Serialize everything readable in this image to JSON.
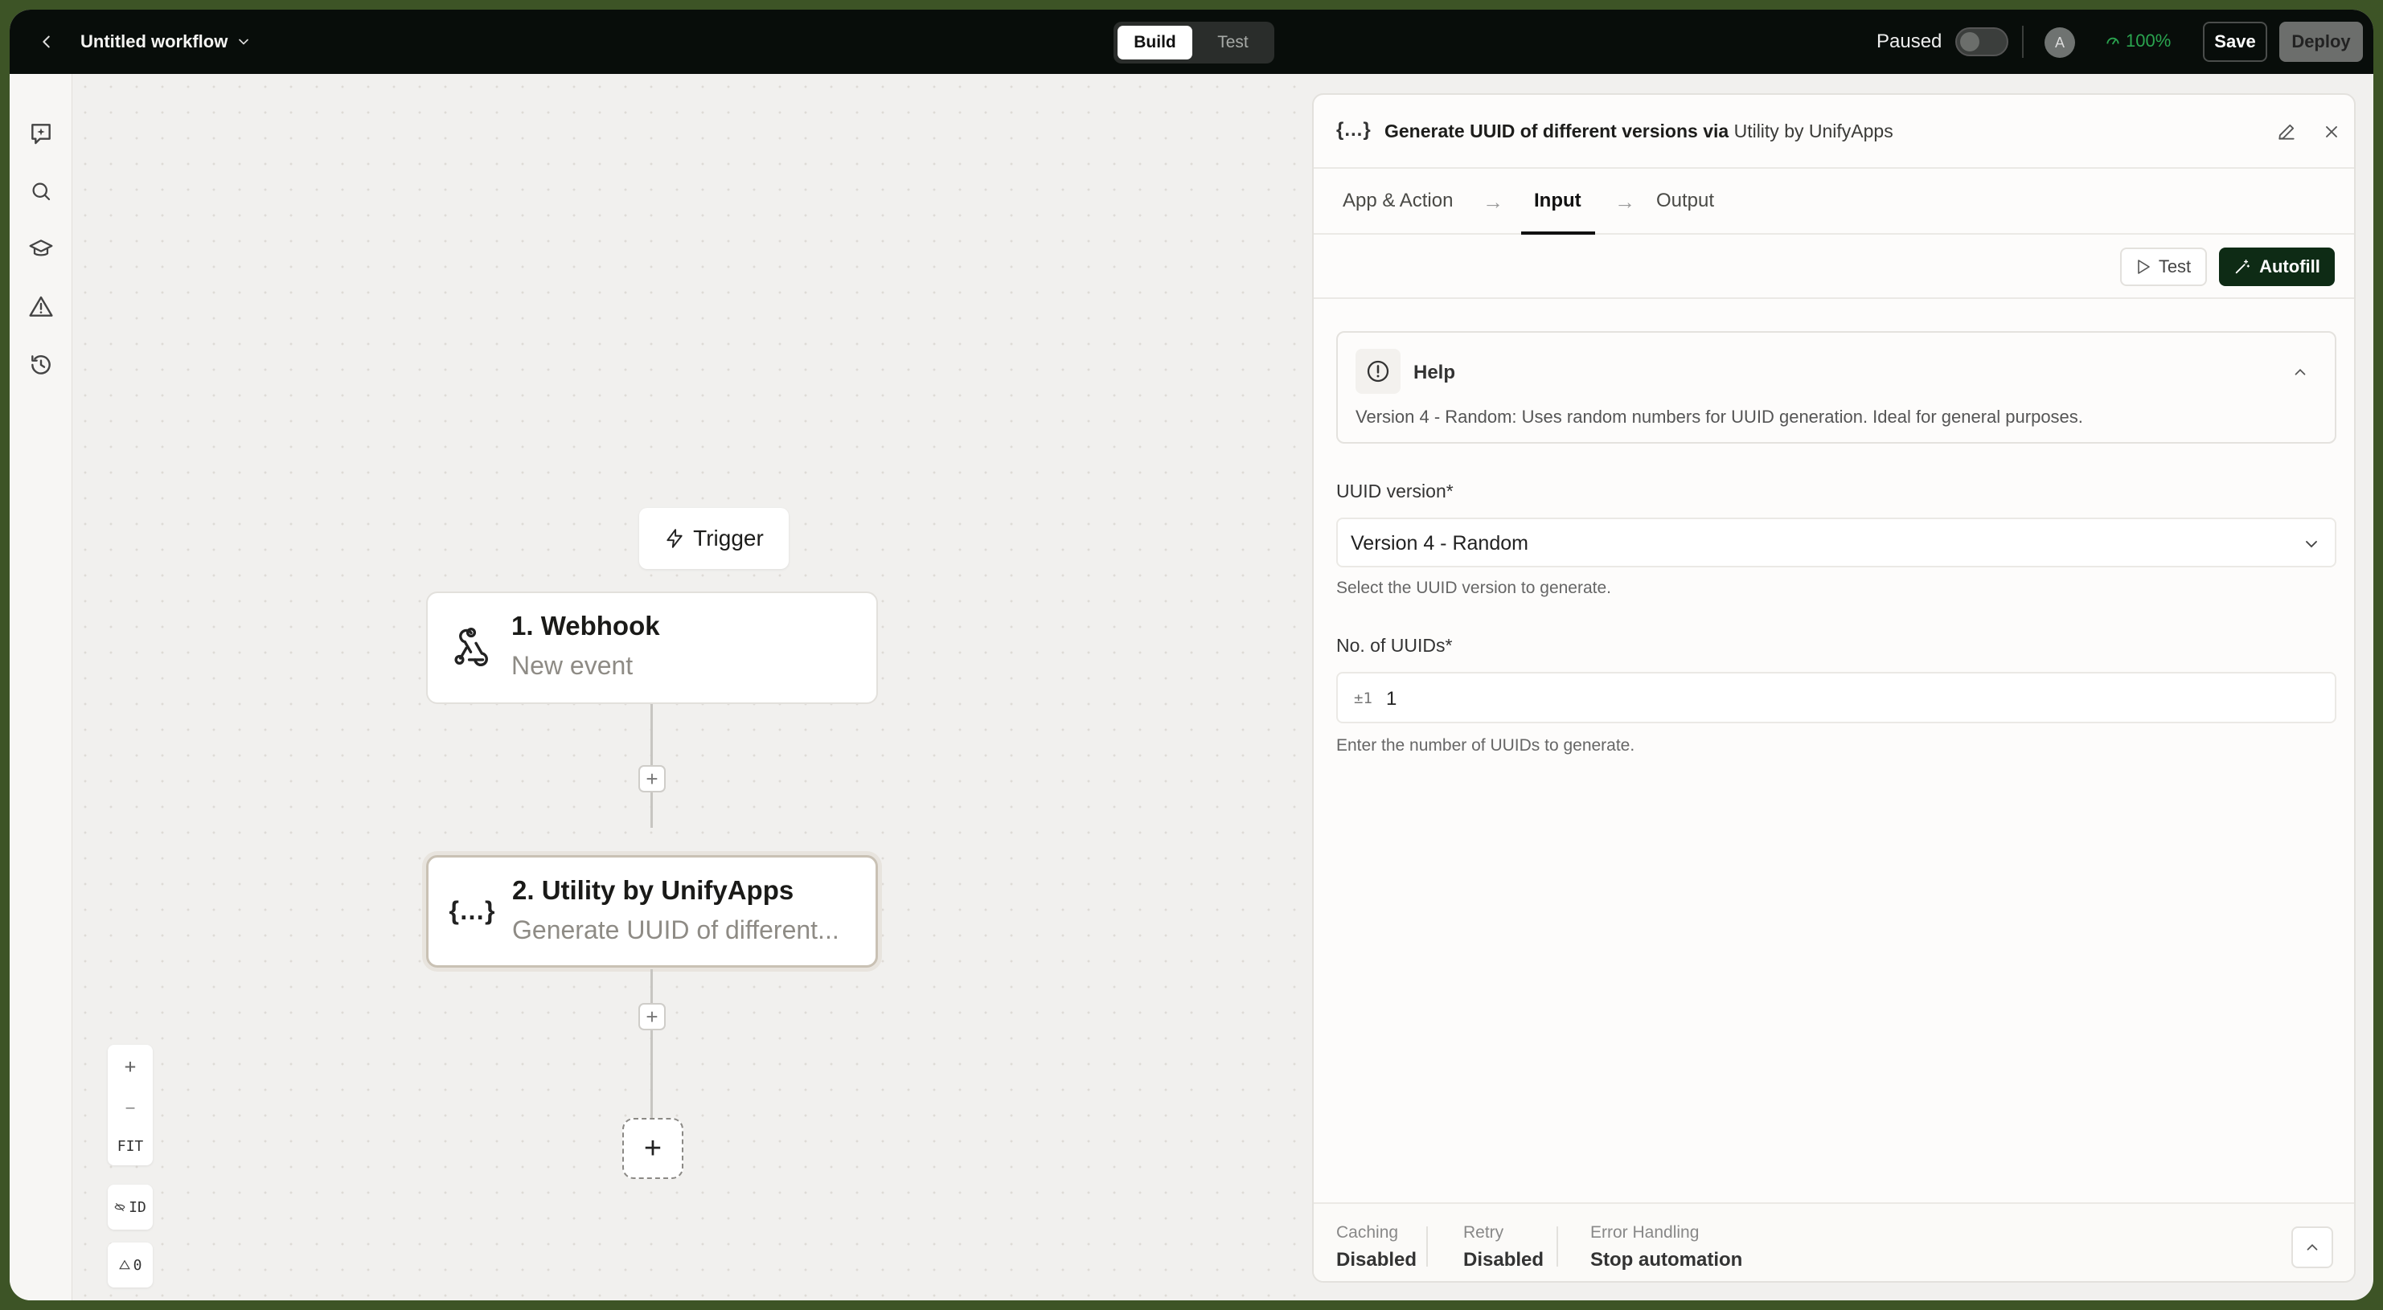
{
  "topbar": {
    "workflow_title": "Untitled workflow",
    "mode_tabs": [
      "Build",
      "Test"
    ],
    "status_label": "Paused",
    "avatar_initial": "A",
    "health_percent": "100%",
    "save_label": "Save",
    "deploy_label": "Deploy"
  },
  "sidebar": {
    "icons": [
      "ai-assistant-icon",
      "search-icon",
      "learn-icon",
      "warning-icon",
      "history-icon"
    ]
  },
  "canvas": {
    "trigger_label": "Trigger",
    "nodes": [
      {
        "title": "1. Webhook",
        "subtitle": "New event",
        "icon": "webhook-icon"
      },
      {
        "title": "2. Utility by UnifyApps",
        "subtitle": "Generate UUID of different...",
        "icon": "braces-icon"
      }
    ],
    "add_step_symbol": "+",
    "controls": {
      "zoom_in": "+",
      "zoom_out": "—",
      "fit": "FIT",
      "id_toggle": "ID",
      "warnings": "0"
    }
  },
  "panel": {
    "title_action": "Generate UUID of different versions via ",
    "title_app": "Utility by UnifyApps",
    "tabs": [
      "App & Action",
      "Input",
      "Output"
    ],
    "active_tab": "Input",
    "test_label": "Test",
    "autofill_label": "Autofill",
    "help": {
      "title": "Help",
      "text": "Version 4 - Random: Uses random numbers for UUID generation. Ideal for general purposes."
    },
    "uuid_version": {
      "label": "UUID version*",
      "value": "Version 4 - Random",
      "hint": "Select the UUID version to generate."
    },
    "num_uuids": {
      "label": "No. of UUIDs*",
      "prefix": "±1",
      "value": "1",
      "hint": "Enter the number of UUIDs to generate."
    },
    "footer": {
      "caching_label": "Caching",
      "caching_value": "Disabled",
      "retry_label": "Retry",
      "retry_value": "Disabled",
      "error_label": "Error Handling",
      "error_value": "Stop automation"
    }
  },
  "colors": {
    "topbar_bg": "#080d0a",
    "autofill_bg": "#0e2b15",
    "health_green": "#2aa44f",
    "canvas_bg": "#f1f0ee"
  }
}
